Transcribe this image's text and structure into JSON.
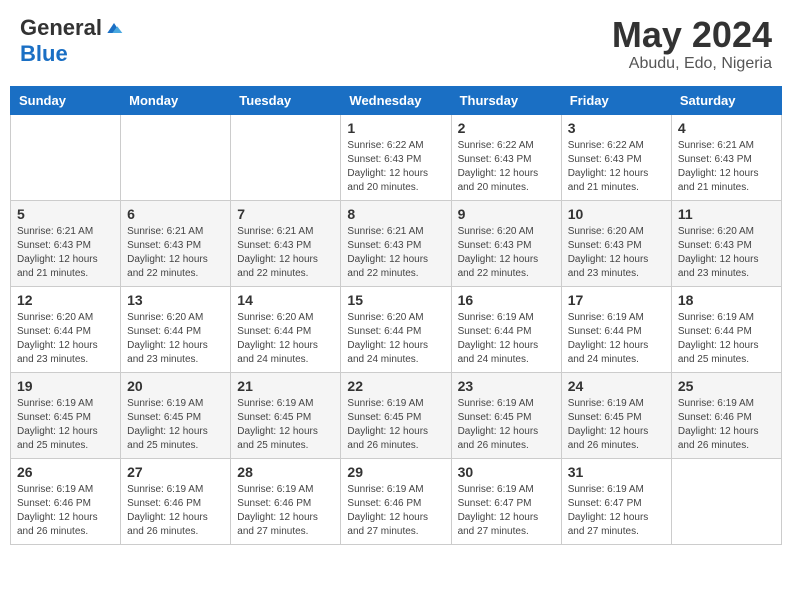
{
  "header": {
    "logo_general": "General",
    "logo_blue": "Blue",
    "month_title": "May 2024",
    "location": "Abudu, Edo, Nigeria"
  },
  "weekdays": [
    "Sunday",
    "Monday",
    "Tuesday",
    "Wednesday",
    "Thursday",
    "Friday",
    "Saturday"
  ],
  "weeks": [
    [
      {
        "day": "",
        "info": ""
      },
      {
        "day": "",
        "info": ""
      },
      {
        "day": "",
        "info": ""
      },
      {
        "day": "1",
        "info": "Sunrise: 6:22 AM\nSunset: 6:43 PM\nDaylight: 12 hours\nand 20 minutes."
      },
      {
        "day": "2",
        "info": "Sunrise: 6:22 AM\nSunset: 6:43 PM\nDaylight: 12 hours\nand 20 minutes."
      },
      {
        "day": "3",
        "info": "Sunrise: 6:22 AM\nSunset: 6:43 PM\nDaylight: 12 hours\nand 21 minutes."
      },
      {
        "day": "4",
        "info": "Sunrise: 6:21 AM\nSunset: 6:43 PM\nDaylight: 12 hours\nand 21 minutes."
      }
    ],
    [
      {
        "day": "5",
        "info": "Sunrise: 6:21 AM\nSunset: 6:43 PM\nDaylight: 12 hours\nand 21 minutes."
      },
      {
        "day": "6",
        "info": "Sunrise: 6:21 AM\nSunset: 6:43 PM\nDaylight: 12 hours\nand 22 minutes."
      },
      {
        "day": "7",
        "info": "Sunrise: 6:21 AM\nSunset: 6:43 PM\nDaylight: 12 hours\nand 22 minutes."
      },
      {
        "day": "8",
        "info": "Sunrise: 6:21 AM\nSunset: 6:43 PM\nDaylight: 12 hours\nand 22 minutes."
      },
      {
        "day": "9",
        "info": "Sunrise: 6:20 AM\nSunset: 6:43 PM\nDaylight: 12 hours\nand 22 minutes."
      },
      {
        "day": "10",
        "info": "Sunrise: 6:20 AM\nSunset: 6:43 PM\nDaylight: 12 hours\nand 23 minutes."
      },
      {
        "day": "11",
        "info": "Sunrise: 6:20 AM\nSunset: 6:43 PM\nDaylight: 12 hours\nand 23 minutes."
      }
    ],
    [
      {
        "day": "12",
        "info": "Sunrise: 6:20 AM\nSunset: 6:44 PM\nDaylight: 12 hours\nand 23 minutes."
      },
      {
        "day": "13",
        "info": "Sunrise: 6:20 AM\nSunset: 6:44 PM\nDaylight: 12 hours\nand 23 minutes."
      },
      {
        "day": "14",
        "info": "Sunrise: 6:20 AM\nSunset: 6:44 PM\nDaylight: 12 hours\nand 24 minutes."
      },
      {
        "day": "15",
        "info": "Sunrise: 6:20 AM\nSunset: 6:44 PM\nDaylight: 12 hours\nand 24 minutes."
      },
      {
        "day": "16",
        "info": "Sunrise: 6:19 AM\nSunset: 6:44 PM\nDaylight: 12 hours\nand 24 minutes."
      },
      {
        "day": "17",
        "info": "Sunrise: 6:19 AM\nSunset: 6:44 PM\nDaylight: 12 hours\nand 24 minutes."
      },
      {
        "day": "18",
        "info": "Sunrise: 6:19 AM\nSunset: 6:44 PM\nDaylight: 12 hours\nand 25 minutes."
      }
    ],
    [
      {
        "day": "19",
        "info": "Sunrise: 6:19 AM\nSunset: 6:45 PM\nDaylight: 12 hours\nand 25 minutes."
      },
      {
        "day": "20",
        "info": "Sunrise: 6:19 AM\nSunset: 6:45 PM\nDaylight: 12 hours\nand 25 minutes."
      },
      {
        "day": "21",
        "info": "Sunrise: 6:19 AM\nSunset: 6:45 PM\nDaylight: 12 hours\nand 25 minutes."
      },
      {
        "day": "22",
        "info": "Sunrise: 6:19 AM\nSunset: 6:45 PM\nDaylight: 12 hours\nand 26 minutes."
      },
      {
        "day": "23",
        "info": "Sunrise: 6:19 AM\nSunset: 6:45 PM\nDaylight: 12 hours\nand 26 minutes."
      },
      {
        "day": "24",
        "info": "Sunrise: 6:19 AM\nSunset: 6:45 PM\nDaylight: 12 hours\nand 26 minutes."
      },
      {
        "day": "25",
        "info": "Sunrise: 6:19 AM\nSunset: 6:46 PM\nDaylight: 12 hours\nand 26 minutes."
      }
    ],
    [
      {
        "day": "26",
        "info": "Sunrise: 6:19 AM\nSunset: 6:46 PM\nDaylight: 12 hours\nand 26 minutes."
      },
      {
        "day": "27",
        "info": "Sunrise: 6:19 AM\nSunset: 6:46 PM\nDaylight: 12 hours\nand 26 minutes."
      },
      {
        "day": "28",
        "info": "Sunrise: 6:19 AM\nSunset: 6:46 PM\nDaylight: 12 hours\nand 27 minutes."
      },
      {
        "day": "29",
        "info": "Sunrise: 6:19 AM\nSunset: 6:46 PM\nDaylight: 12 hours\nand 27 minutes."
      },
      {
        "day": "30",
        "info": "Sunrise: 6:19 AM\nSunset: 6:47 PM\nDaylight: 12 hours\nand 27 minutes."
      },
      {
        "day": "31",
        "info": "Sunrise: 6:19 AM\nSunset: 6:47 PM\nDaylight: 12 hours\nand 27 minutes."
      },
      {
        "day": "",
        "info": ""
      }
    ]
  ]
}
